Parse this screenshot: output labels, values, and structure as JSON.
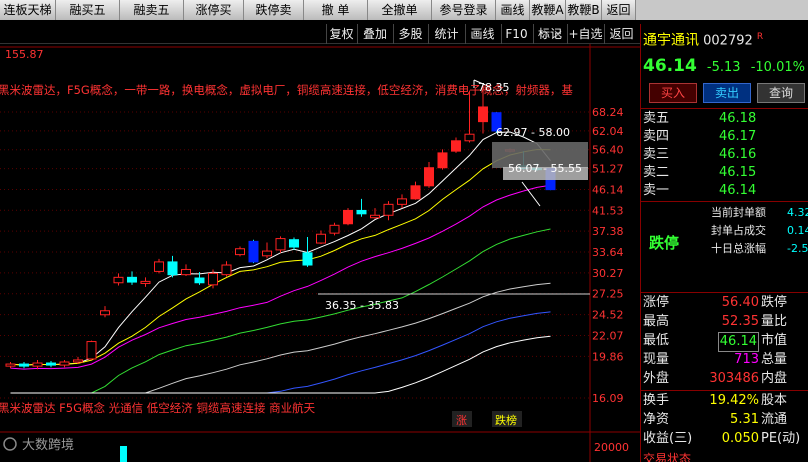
{
  "toolbar": {
    "buttons": [
      "连板天梯",
      "融买五",
      "融卖五",
      "涨停买",
      "跌停卖",
      "撤 单",
      "全撤单",
      "参号登录",
      "画线",
      "教鞭A",
      "教鞭B",
      "返回"
    ]
  },
  "subbar": {
    "buttons": [
      "复权",
      "叠加",
      "多股",
      "统计",
      "画线",
      "F10",
      "标记",
      "+自选",
      "返回"
    ],
    "collapse_icons": "◇ ×"
  },
  "chart": {
    "top_price_label": "155.87",
    "concepts_top": "黑米波雷达，F5G概念，一带一路，换电概念，虚拟电厂，铜缆高速连接，低空经济，消费电子概念，射频器，基",
    "concepts_bottom": "黑米波雷达 F5G概念 光通信 低空经济 铜缆高速连接 商业航天",
    "annotation_high": "78.35",
    "annotation_box1": "62.97 - 58.00",
    "annotation_box2": "56.07 - 55.55",
    "annotation_box3": "36.35 - 35.83",
    "tag_zhang": "涨",
    "tag_dieban": "跌榜",
    "y_ticks": [
      "68.24",
      "62.04",
      "56.40",
      "51.27",
      "46.14",
      "41.53",
      "37.38",
      "33.64",
      "30.27",
      "27.25",
      "24.52",
      "22.07",
      "19.86",
      "16.09"
    ],
    "vol_tick": "20000",
    "watermark": "大数跨境"
  },
  "chart_data": {
    "type": "candlestick",
    "candles": [
      {
        "o": 18.9,
        "c": 19.1,
        "h": 19.3,
        "l": 18.7
      },
      {
        "o": 19.1,
        "c": 18.9,
        "h": 19.3,
        "l": 18.7
      },
      {
        "o": 18.9,
        "c": 19.2,
        "h": 19.5,
        "l": 18.6
      },
      {
        "o": 19.2,
        "c": 19.0,
        "h": 19.4,
        "l": 18.8
      },
      {
        "o": 19.0,
        "c": 19.3,
        "h": 19.5,
        "l": 18.8
      },
      {
        "o": 19.3,
        "c": 19.5,
        "h": 19.8,
        "l": 19.1
      },
      {
        "o": 19.6,
        "c": 21.4,
        "h": 21.5,
        "l": 19.5
      },
      {
        "o": 24.5,
        "c": 25.0,
        "h": 25.6,
        "l": 24.2
      },
      {
        "o": 28.8,
        "c": 29.6,
        "h": 30.2,
        "l": 28.4
      },
      {
        "o": 29.6,
        "c": 28.9,
        "h": 30.5,
        "l": 28.5
      },
      {
        "o": 28.7,
        "c": 29.0,
        "h": 29.6,
        "l": 28.2
      },
      {
        "o": 30.5,
        "c": 32.0,
        "h": 32.5,
        "l": 30.2
      },
      {
        "o": 32.0,
        "c": 30.0,
        "h": 33.0,
        "l": 29.6
      },
      {
        "o": 30.0,
        "c": 30.8,
        "h": 31.6,
        "l": 29.8
      },
      {
        "o": 29.5,
        "c": 28.8,
        "h": 30.4,
        "l": 28.5
      },
      {
        "o": 28.5,
        "c": 30.2,
        "h": 30.8,
        "l": 28.0
      },
      {
        "o": 30.0,
        "c": 31.5,
        "h": 32.1,
        "l": 29.7
      },
      {
        "o": 33.2,
        "c": 34.2,
        "h": 34.6,
        "l": 32.9
      },
      {
        "o": 35.5,
        "c": 32.0,
        "h": 35.8,
        "l": 31.8
      },
      {
        "o": 33.0,
        "c": 33.8,
        "h": 35.3,
        "l": 32.6
      },
      {
        "o": 34.0,
        "c": 36.0,
        "h": 36.4,
        "l": 33.5
      },
      {
        "o": 35.8,
        "c": 34.5,
        "h": 36.2,
        "l": 34.0
      },
      {
        "o": 33.5,
        "c": 31.5,
        "h": 36.3,
        "l": 31.2
      },
      {
        "o": 35.2,
        "c": 36.8,
        "h": 37.5,
        "l": 35.0
      },
      {
        "o": 37.0,
        "c": 38.5,
        "h": 39.0,
        "l": 36.6
      },
      {
        "o": 38.8,
        "c": 41.5,
        "h": 42.0,
        "l": 38.5
      },
      {
        "o": 41.5,
        "c": 40.8,
        "h": 44.0,
        "l": 40.2
      },
      {
        "o": 40.0,
        "c": 40.5,
        "h": 42.0,
        "l": 39.8
      },
      {
        "o": 40.5,
        "c": 42.8,
        "h": 43.5,
        "l": 39.5
      },
      {
        "o": 42.8,
        "c": 44.0,
        "h": 45.0,
        "l": 42.0
      },
      {
        "o": 44.0,
        "c": 47.0,
        "h": 48.0,
        "l": 43.8
      },
      {
        "o": 47.0,
        "c": 51.5,
        "h": 53.0,
        "l": 46.5
      },
      {
        "o": 51.5,
        "c": 55.5,
        "h": 56.5,
        "l": 51.0
      },
      {
        "o": 56.0,
        "c": 59.0,
        "h": 60.0,
        "l": 55.5
      },
      {
        "o": 59.0,
        "c": 61.0,
        "h": 76.0,
        "l": 58.5
      },
      {
        "o": 65.0,
        "c": 70.0,
        "h": 78.3,
        "l": 61.2
      },
      {
        "o": 68.0,
        "c": 62.0,
        "h": 68.2,
        "l": 61.5
      },
      {
        "o": 56.0,
        "c": 56.4,
        "h": 56.8,
        "l": 55.6
      },
      {
        "o": 52.0,
        "c": 51.3,
        "h": 56.0,
        "l": 51.0
      },
      {
        "o": 51.5,
        "c": 51.0,
        "h": 52.8,
        "l": 50.7
      },
      {
        "o": 51.3,
        "c": 46.1,
        "h": 51.6,
        "l": 46.0
      }
    ],
    "ma": [
      {
        "name": "MA5",
        "color": "#ffffff"
      },
      {
        "name": "MA10",
        "color": "#ffff00"
      },
      {
        "name": "MA20",
        "color": "#ff00ff"
      },
      {
        "name": "MA30",
        "color": "#33dd33"
      },
      {
        "name": "MA60",
        "color": "#cccccc"
      },
      {
        "name": "MA120",
        "color": "#3355ff"
      },
      {
        "name": "MA250",
        "color": "#ffffff"
      }
    ]
  },
  "sidepanel": {
    "stock_name": "通宇通讯",
    "stock_code": "002792",
    "r_badge": "R",
    "price": "46.14",
    "change": "-5.13",
    "change_pct": "-10.01%",
    "buy_btn": "买入",
    "sell_btn": "卖出",
    "query_btn": "查询",
    "asks": [
      {
        "label": "卖五",
        "price": "46.18"
      },
      {
        "label": "卖四",
        "price": "46.17"
      },
      {
        "label": "卖三",
        "price": "46.16"
      },
      {
        "label": "卖二",
        "price": "46.15"
      },
      {
        "label": "卖一",
        "price": "46.14"
      }
    ],
    "limit_state": "跌停",
    "seal_rows": [
      {
        "label": "当前封单额",
        "value": "4.32"
      },
      {
        "label": "封单占成交",
        "value": "0.14"
      },
      {
        "label": "十日总涨幅",
        "value": "-2.5"
      }
    ],
    "stats": [
      {
        "l1": "涨停",
        "v1": "56.40",
        "l2": "跌停"
      },
      {
        "l1": "最高",
        "v1": "52.35",
        "l2": "量比"
      },
      {
        "l1": "最低",
        "v1": "46.14",
        "l2": "市值"
      },
      {
        "l1": "现量",
        "v1": "713",
        "l2": "总量"
      },
      {
        "l1": "外盘",
        "v1": "303486",
        "l2": "内盘"
      }
    ],
    "stats2": [
      {
        "l1": "换手",
        "v1": "19.42%",
        "l2": "股本"
      },
      {
        "l1": "净资",
        "v1": "5.31",
        "l2": "流通"
      },
      {
        "l1": "收益(三)",
        "v1": "0.050",
        "l2": "PE(动)"
      }
    ],
    "bottom_cut": "交易状态"
  }
}
